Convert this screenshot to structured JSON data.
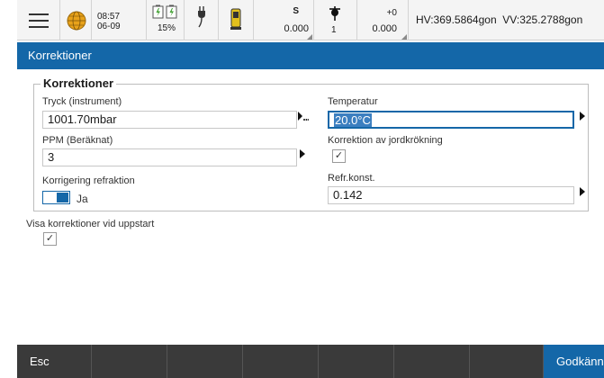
{
  "status": {
    "icons": {
      "menu": "hamburger-menu-icon",
      "globe": "globe-icon",
      "battery": "battery-icon",
      "plug": "power-plug-icon",
      "instrument": "total-station-icon",
      "prism": "prism-icon"
    },
    "time": "08:57",
    "date": "06-09",
    "battery_percent": "15%",
    "s_label": "S",
    "s_value": "0.000",
    "prism_number": "1",
    "prism_offset": "+0",
    "prism_value": "0.000",
    "hv_readout": "HV:369.5864gon  VV:325.2788gon"
  },
  "title": "Korrektioner",
  "group": {
    "legend": "Korrektioner",
    "pressure_label": "Tryck (instrument)",
    "pressure_value": "1001.70mbar",
    "ppm_label": "PPM (Beräknat)",
    "ppm_value": "3",
    "refraction_label": "Korrigering refraktion",
    "refraction_toggle_label": "Ja",
    "refraction_enabled": true,
    "temperature_label": "Temperatur",
    "temperature_value": "20.0°C",
    "curvature_label": "Korrektion av jordkrökning",
    "curvature_checked": true,
    "refr_const_label": "Refr.konst.",
    "refr_const_value": "0.142"
  },
  "show_on_startup_label": "Visa korrektioner vid uppstart",
  "show_on_startup_checked": true,
  "checkmark": "✓",
  "footer": {
    "esc_label": "Esc",
    "accept_label": "Godkänn",
    "empty_slots": 6
  },
  "colors": {
    "accent": "#1467a8",
    "footer_bg": "#3a3a3a",
    "statusbar_bg": "#f4f4f4"
  }
}
